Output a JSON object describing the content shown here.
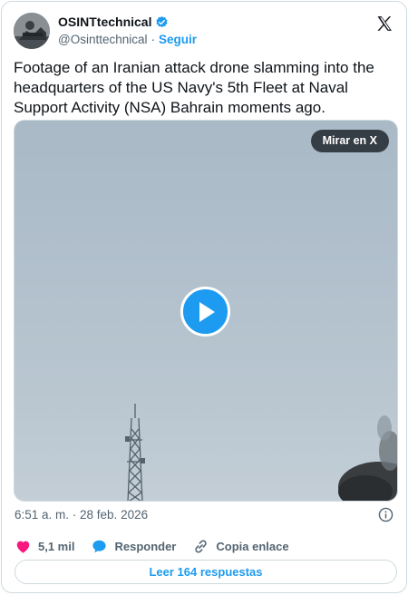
{
  "author": {
    "name": "OSINTtechnical",
    "handle": "@Osinttechnical",
    "separator": "·",
    "follow_label": "Seguir"
  },
  "tweet": {
    "text": "Footage of an Iranian attack drone slamming into the headquarters of the US Navy's 5th Fleet at Naval Support Activity (NSA) Bahrain moments ago."
  },
  "media": {
    "watch_on_x_label": "Mirar en X",
    "play_icon": "play-icon"
  },
  "meta": {
    "timestamp": "6:51 a. m. · 28 feb. 2026",
    "info_icon": "info-icon"
  },
  "actions": {
    "like_count": "5,1 mil",
    "reply_label": "Responder",
    "copy_link_label": "Copia enlace"
  },
  "footer": {
    "read_replies_label": "Leer 164 respuestas"
  },
  "colors": {
    "accent": "#1d9bf0",
    "like": "#f91880",
    "text": "#0f1419",
    "secondary": "#536471",
    "border": "#cfd9de"
  }
}
